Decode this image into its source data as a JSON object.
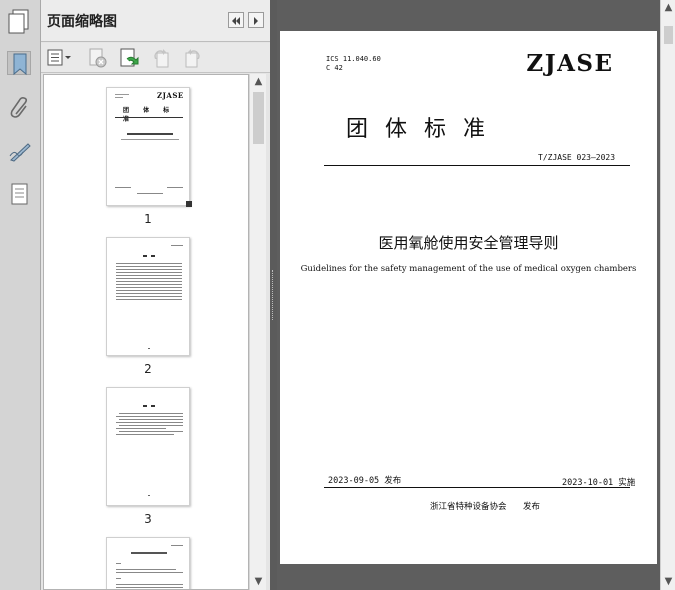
{
  "sidebar": {
    "title": "页面缩略图",
    "thumbnails": [
      {
        "page_label": "1"
      },
      {
        "page_label": "2"
      },
      {
        "page_label": "3"
      }
    ]
  },
  "document": {
    "ics": "ICS 11.040.60",
    "ccs": "C 42",
    "logo_text": "ZJASE",
    "standard_type": "团  体  标  准",
    "standard_number": "T/ZJASE 023—2023",
    "title_cn": "医用氧舱使用安全管理导则",
    "title_en": "Guidelines for the safety management of the use of medical oxygen chambers",
    "publish_date": "2023-09-05 发布",
    "implement_date": "2023-10-01 实施",
    "publisher": "浙江省特种设备协会",
    "publish_word": "发布"
  },
  "icons": [
    "pages-icon",
    "bookmark-icon",
    "attachment-icon",
    "signature-icon",
    "layers-icon",
    "first-page-icon",
    "next-page-icon",
    "options-icon",
    "delete-page-icon",
    "insert-page-icon",
    "rotate-ccw-icon",
    "rotate-cw-icon"
  ]
}
